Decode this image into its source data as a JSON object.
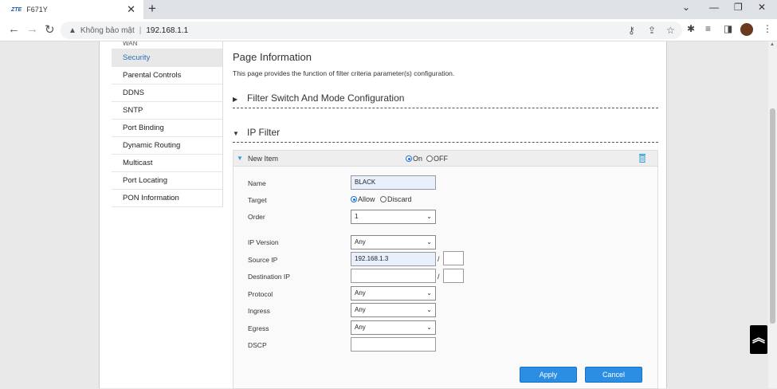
{
  "browser": {
    "tab_logo": "ZTE",
    "tab_title": "F671Y",
    "tab_close": "✕",
    "new_tab": "+",
    "security_label": "Không bảo mật",
    "url": "192.168.1.1"
  },
  "sidemenu": {
    "items": [
      {
        "label": "WAN"
      },
      {
        "label": "Security"
      },
      {
        "label": "Parental Controls"
      },
      {
        "label": "DDNS"
      },
      {
        "label": "SNTP"
      },
      {
        "label": "Port Binding"
      },
      {
        "label": "Dynamic Routing"
      },
      {
        "label": "Multicast"
      },
      {
        "label": "Port Locating"
      },
      {
        "label": "PON Information"
      }
    ]
  },
  "main": {
    "title": "Page Information",
    "description": "This page provides the function of filter criteria parameter(s) configuration.",
    "section_filter_switch": "Filter Switch And Mode Configuration",
    "section_ip_filter": "IP Filter"
  },
  "item": {
    "header": "New Item",
    "on_label": "On",
    "off_label": "OFF",
    "fields": {
      "name_label": "Name",
      "name_value": "BLACK",
      "target_label": "Target",
      "target_allow": "Allow",
      "target_discard": "Discard",
      "order_label": "Order",
      "order_value": "1",
      "ip_version_label": "IP Version",
      "ip_version_value": "Any",
      "source_ip_label": "Source IP",
      "source_ip_value": "192.168.1.3",
      "destination_ip_label": "Destination IP",
      "destination_ip_value": "",
      "protocol_label": "Protocol",
      "protocol_value": "Any",
      "ingress_label": "Ingress",
      "ingress_value": "Any",
      "egress_label": "Egress",
      "egress_value": "Any",
      "dscp_label": "DSCP",
      "dscp_value": "",
      "slash": "/"
    }
  },
  "buttons": {
    "apply": "Apply",
    "cancel": "Cancel"
  },
  "colors": {
    "accent": "#2b8ee3",
    "active_menu_text": "#2a6ebb"
  }
}
